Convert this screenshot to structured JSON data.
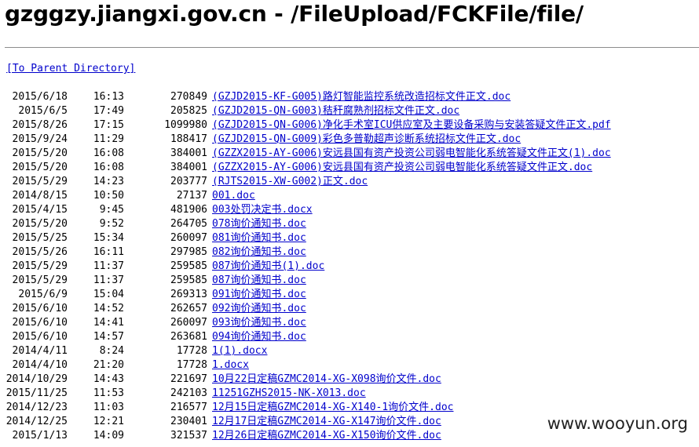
{
  "page": {
    "title": "gzggzy.jiangxi.gov.cn - /FileUpload/FCKFile/file/",
    "parent_link": "[To Parent Directory]"
  },
  "files": [
    {
      "date": "2015/6/18",
      "time": "16:13",
      "size": "270849",
      "name": "(GZJD2015-KF-G005)路灯智能监控系统改造招标文件正文.doc"
    },
    {
      "date": "2015/6/5",
      "time": "17:49",
      "size": "205825",
      "name": "(GZJD2015-QN-G003)秸秆腐熟剂招标文件正文.doc"
    },
    {
      "date": "2015/8/26",
      "time": "17:15",
      "size": "1099980",
      "name": "(GZJD2015-QN-G006)净化手术室ICU供应室及主要设备采购与安装答疑文件正文.pdf"
    },
    {
      "date": "2015/9/24",
      "time": "11:29",
      "size": "188417",
      "name": "(GZJD2015-QN-G009)彩色多普勒超声诊断系统招标文件正文.doc"
    },
    {
      "date": "2015/5/20",
      "time": "16:08",
      "size": "384001",
      "name": "(GZZX2015-AY-G006)安远县国有资产投资公司弱电智能化系统答疑文件正文(1).doc"
    },
    {
      "date": "2015/5/20",
      "time": "16:08",
      "size": "384001",
      "name": "(GZZX2015-AY-G006)安远县国有资产投资公司弱电智能化系统答疑文件正文.doc"
    },
    {
      "date": "2015/5/29",
      "time": "14:23",
      "size": "203777",
      "name": "(RJTS2015-XW-G002)正文.doc"
    },
    {
      "date": "2014/8/15",
      "time": "10:50",
      "size": "27137",
      "name": "001.doc"
    },
    {
      "date": "2015/4/15",
      "time": "9:45",
      "size": "481906",
      "name": "003处罚决定书.docx"
    },
    {
      "date": "2015/5/20",
      "time": "9:52",
      "size": "264705",
      "name": "078询价通知书.doc"
    },
    {
      "date": "2015/5/25",
      "time": "15:34",
      "size": "260097",
      "name": "081询价通知书.doc"
    },
    {
      "date": "2015/5/26",
      "time": "16:11",
      "size": "297985",
      "name": "082询价通知书.doc"
    },
    {
      "date": "2015/5/29",
      "time": "11:37",
      "size": "259585",
      "name": "087询价通知书(1).doc"
    },
    {
      "date": "2015/5/29",
      "time": "11:37",
      "size": "259585",
      "name": "087询价通知书.doc"
    },
    {
      "date": "2015/6/9",
      "time": "15:04",
      "size": "269313",
      "name": "091询价通知书.doc"
    },
    {
      "date": "2015/6/10",
      "time": "14:52",
      "size": "262657",
      "name": "092询价通知书.doc"
    },
    {
      "date": "2015/6/10",
      "time": "14:41",
      "size": "260097",
      "name": "093询价通知书.doc"
    },
    {
      "date": "2015/6/10",
      "time": "14:57",
      "size": "263681",
      "name": "094询价通知书.doc"
    },
    {
      "date": "2014/4/11",
      "time": "8:24",
      "size": "17728",
      "name": "1(1).docx"
    },
    {
      "date": "2014/4/10",
      "time": "21:20",
      "size": "17728",
      "name": "1.docx"
    },
    {
      "date": "2014/10/29",
      "time": "14:43",
      "size": "221697",
      "name": "10月22日定稿GZMC2014-XG-X098询价文件.doc"
    },
    {
      "date": "2015/11/25",
      "time": "11:53",
      "size": "242103",
      "name": "11251GZHS2015-NK-X013.doc"
    },
    {
      "date": "2014/12/23",
      "time": "11:03",
      "size": "216577",
      "name": "12月15日定稿GZMC2014-XG-X140-1询价文件.doc"
    },
    {
      "date": "2014/12/25",
      "time": "12:21",
      "size": "230401",
      "name": "12月17日定稿GZMC2014-XG-X147询价文件.doc"
    },
    {
      "date": "2015/1/13",
      "time": "14:09",
      "size": "321537",
      "name": "12月26日定稿GZMC2014-XG-X150询价文件.doc"
    }
  ],
  "watermark": "www.wooyun.org"
}
